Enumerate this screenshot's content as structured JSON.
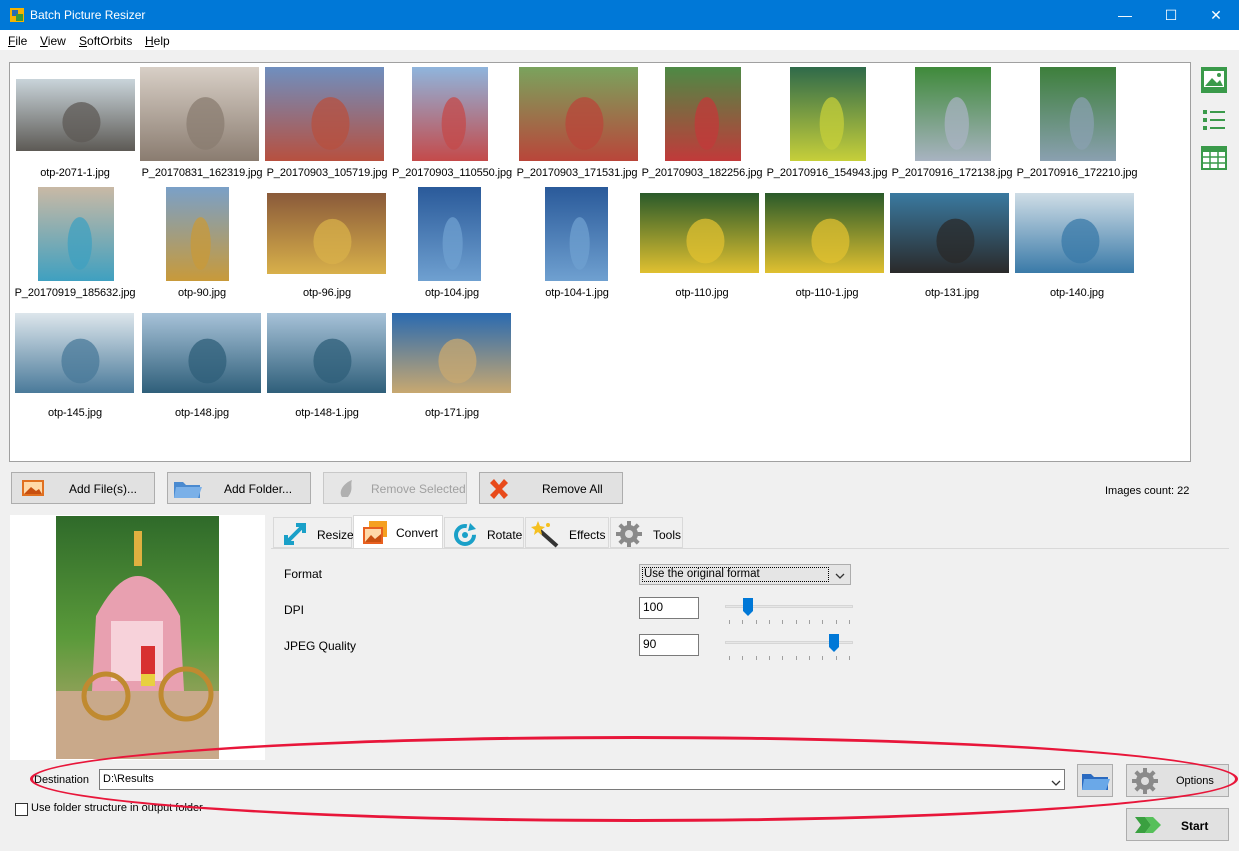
{
  "window": {
    "title": "Batch Picture Resizer",
    "minimize": "—",
    "maximize": "☐",
    "close": "✕",
    "accent_color": "#0078d7"
  },
  "menu": {
    "items": [
      {
        "first": "F",
        "rest": "ile"
      },
      {
        "first": "V",
        "rest": "iew"
      },
      {
        "first": "S",
        "rest": "oftOrbits"
      },
      {
        "first": "H",
        "rest": "elp"
      }
    ]
  },
  "gallery": {
    "thumbnails": [
      {
        "file": "otp-2071-1.jpg",
        "c1": "#c9d4da",
        "c2": "#5d5a55"
      },
      {
        "file": "P_20170831_162319.jpg",
        "c1": "#d8cfc6",
        "c2": "#8a7c70"
      },
      {
        "file": "P_20170903_105719.jpg",
        "c1": "#6f8fbf",
        "c2": "#b7503f"
      },
      {
        "file": "P_20170903_110550.jpg",
        "c1": "#8fb5dd",
        "c2": "#c44a4a"
      },
      {
        "file": "P_20170903_171531.jpg",
        "c1": "#7aa35d",
        "c2": "#b9463a"
      },
      {
        "file": "P_20170903_182256.jpg",
        "c1": "#4d8a45",
        "c2": "#c13a3a"
      },
      {
        "file": "P_20170916_154943.jpg",
        "c1": "#2f6a4a",
        "c2": "#c6cf3a"
      },
      {
        "file": "P_20170916_172138.jpg",
        "c1": "#3f8a3a",
        "c2": "#a8b3c1"
      },
      {
        "file": "P_20170916_172210.jpg",
        "c1": "#3d7f3b",
        "c2": "#8aa0b0"
      },
      {
        "file": "P_20170919_185632.jpg",
        "c1": "#c9b9a5",
        "c2": "#3fa0c0"
      },
      {
        "file": "otp-90.jpg",
        "c1": "#7aa0c8",
        "c2": "#c89a3a"
      },
      {
        "file": "otp-96.jpg",
        "c1": "#8a5a3a",
        "c2": "#d8b04a"
      },
      {
        "file": "otp-104.jpg",
        "c1": "#2a5a9a",
        "c2": "#6fa0d0"
      },
      {
        "file": "otp-104-1.jpg",
        "c1": "#2a5a9a",
        "c2": "#6fa0d0"
      },
      {
        "file": "otp-110.jpg",
        "c1": "#2a5a2a",
        "c2": "#e0c030"
      },
      {
        "file": "otp-110-1.jpg",
        "c1": "#2a5a2a",
        "c2": "#e0c030"
      },
      {
        "file": "otp-131.jpg",
        "c1": "#3a7aa0",
        "c2": "#2a2a2a"
      },
      {
        "file": "otp-140.jpg",
        "c1": "#cfdde6",
        "c2": "#3a7aa8"
      },
      {
        "file": "otp-145.jpg",
        "c1": "#dde6ec",
        "c2": "#4a7a9a"
      },
      {
        "file": "otp-148.jpg",
        "c1": "#a7c2d8",
        "c2": "#2f5f7a"
      },
      {
        "file": "otp-148-1.jpg",
        "c1": "#a7c2d8",
        "c2": "#2f5f7a"
      },
      {
        "file": "otp-171.jpg",
        "c1": "#2a6ab0",
        "c2": "#c8a870"
      }
    ]
  },
  "side_icons": [
    "thumbnail-view-icon",
    "list-view-icon",
    "table-view-icon"
  ],
  "buttons": {
    "add_files": "Add File(s)...",
    "add_folder": "Add Folder...",
    "remove_selected": "Remove Selected",
    "remove_all": "Remove All"
  },
  "images_count": "Images count: 22",
  "tabs": [
    {
      "label": "Resize",
      "icon": "resize-arrow-icon"
    },
    {
      "label": "Convert",
      "icon": "convert-icon"
    },
    {
      "label": "Rotate",
      "icon": "rotate-icon"
    },
    {
      "label": "Effects",
      "icon": "magic-wand-icon"
    },
    {
      "label": "Tools",
      "icon": "gear-icon"
    }
  ],
  "convert": {
    "format_label": "Format",
    "format_value": "Use the original format",
    "dpi_label": "DPI",
    "dpi_value": "100",
    "dpi_level": 0.15,
    "jpeg_label": "JPEG Quality",
    "jpeg_value": "90",
    "jpeg_level": 0.88
  },
  "destination": {
    "label": "Destination",
    "value": "D:\\Results",
    "folder_structure_label": "Use folder structure in output folder",
    "folder_structure_checked": false,
    "options_label": "Options",
    "start_label": "Start"
  }
}
